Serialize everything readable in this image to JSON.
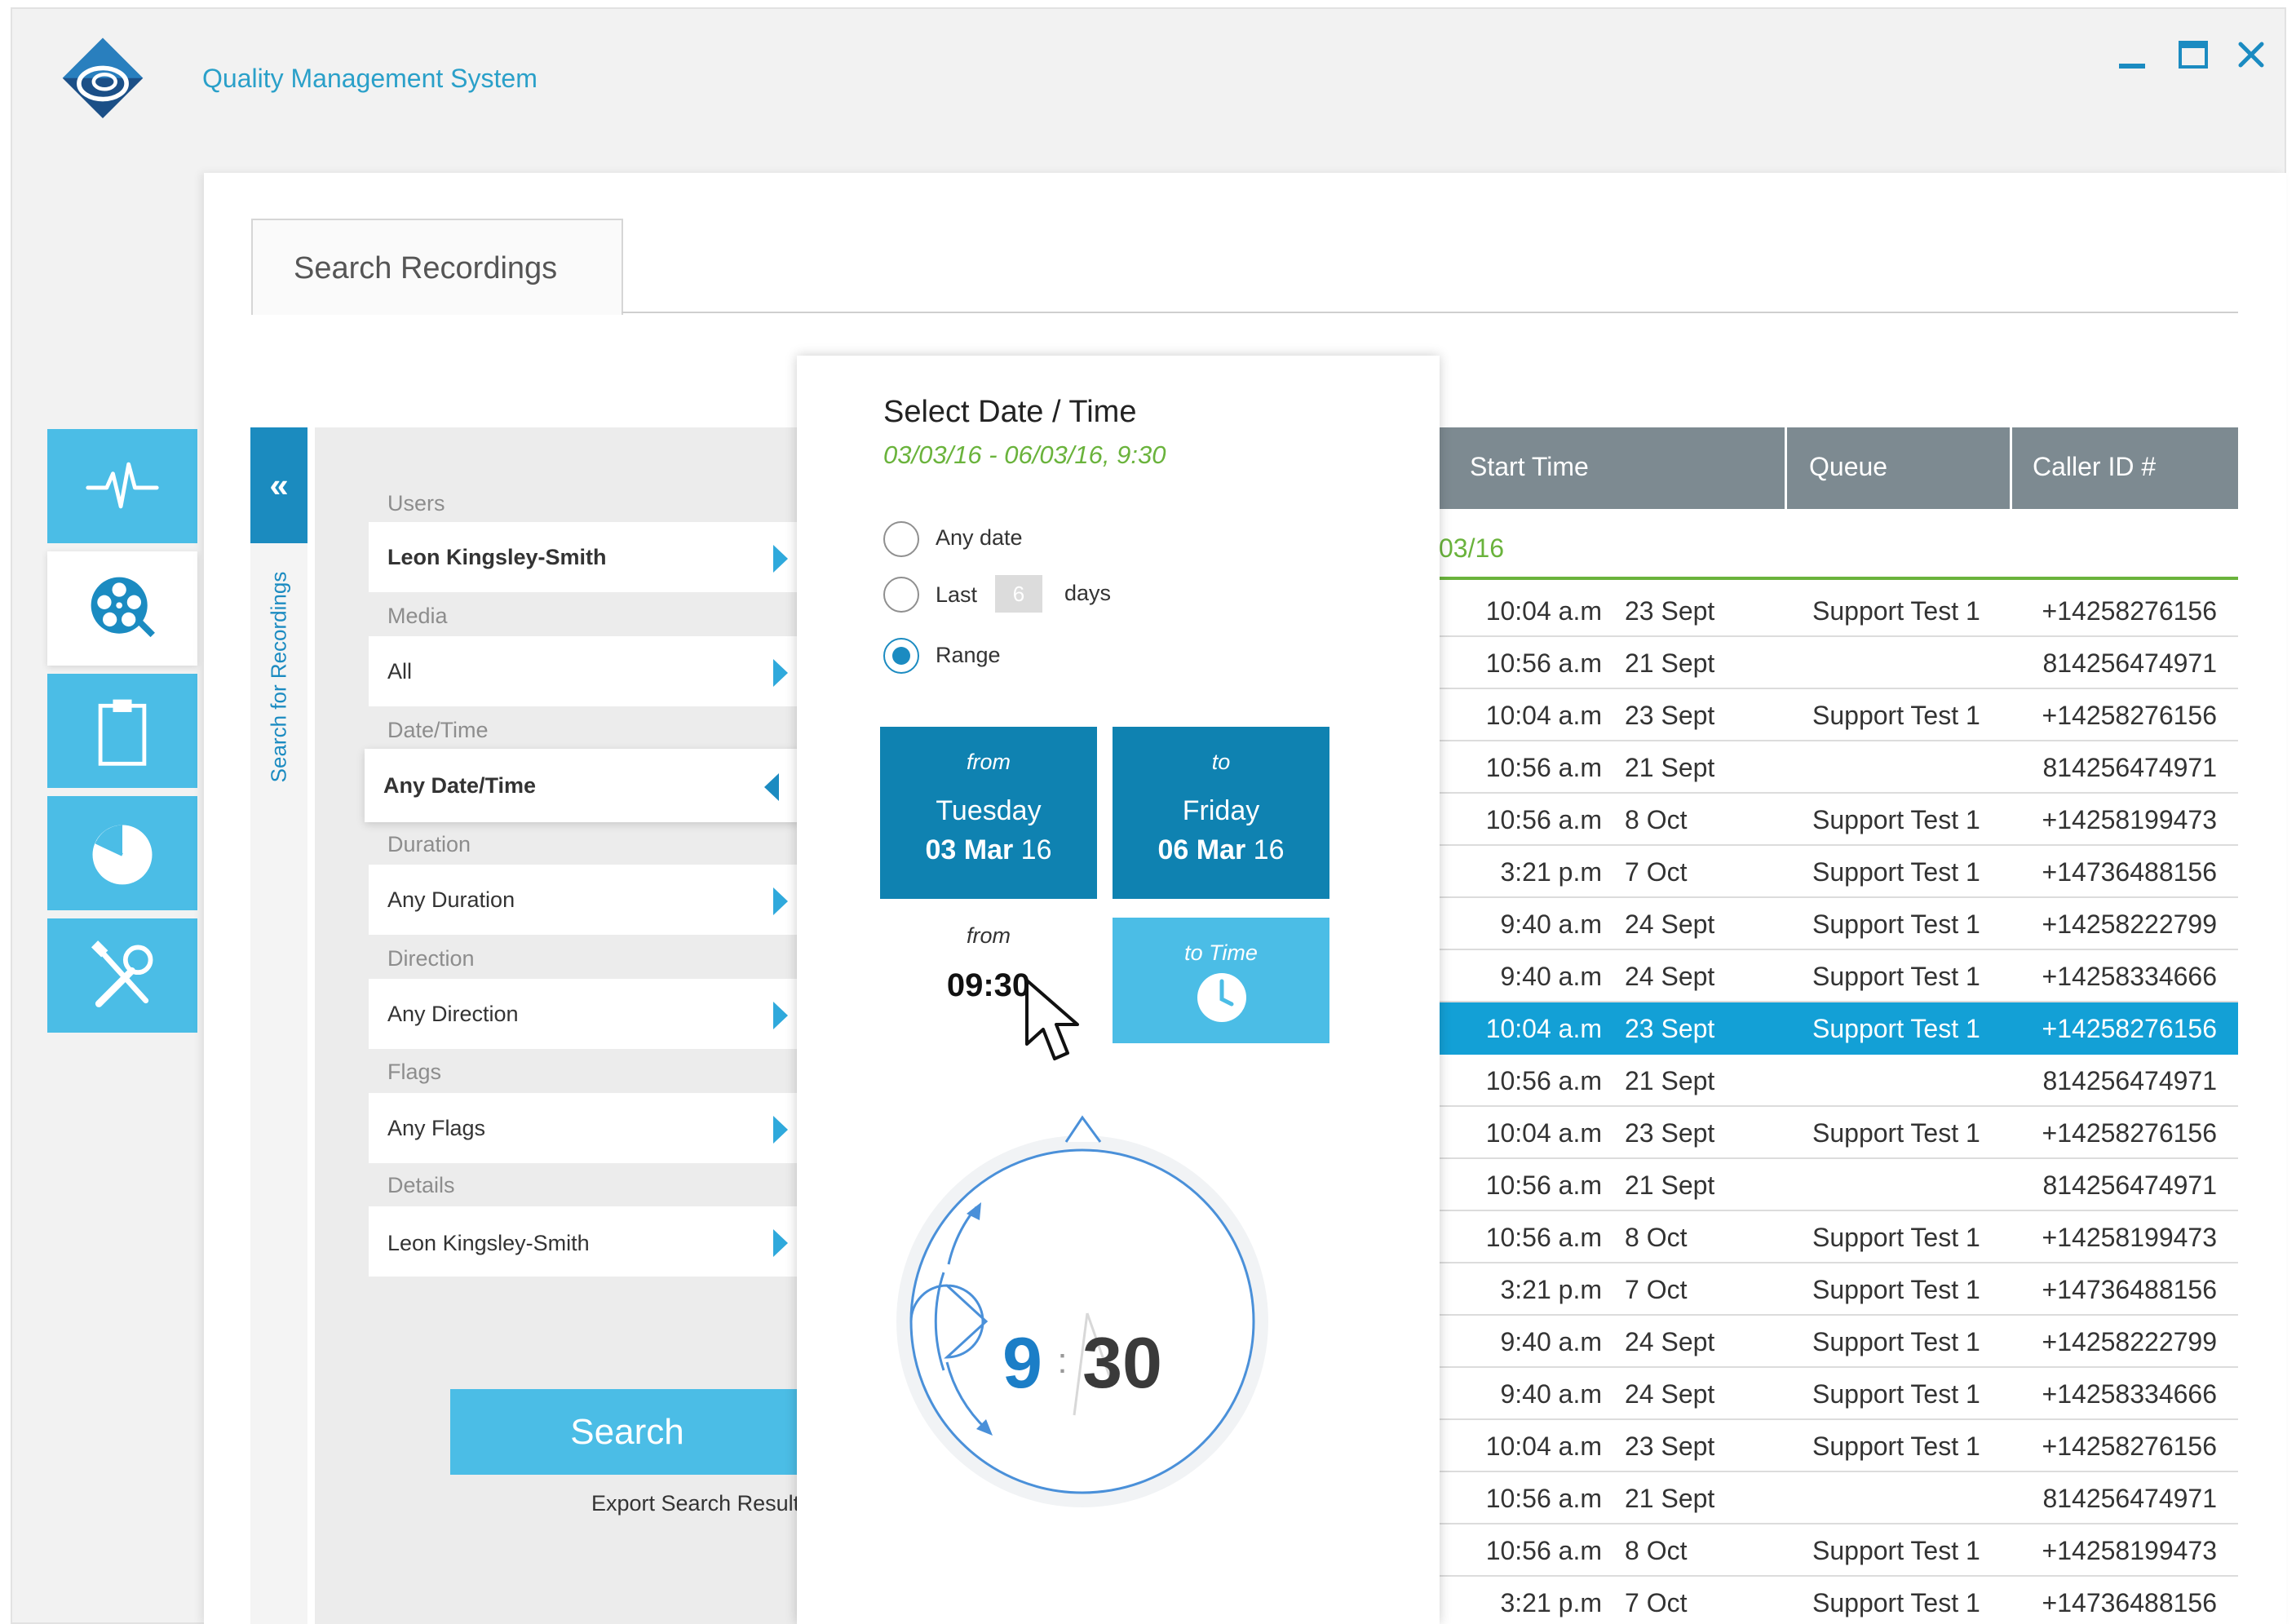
{
  "app": {
    "title": "Quality Management System"
  },
  "tab": {
    "label": "Search Recordings"
  },
  "nav": {
    "items": [
      "activity-icon",
      "film-reel-search-icon",
      "clipboard-icon",
      "pie-chart-icon",
      "tools-icon"
    ],
    "active_index": 1
  },
  "side_panel": {
    "vertical_label": "Search for Recordings",
    "collapse_glyph": "«"
  },
  "filters": {
    "users_label": "Users",
    "users_value": "Leon Kingsley-Smith",
    "media_label": "Media",
    "media_value": "All",
    "datetime_label": "Date/Time",
    "datetime_value": "Any Date/Time",
    "duration_label": "Duration",
    "duration_value": "Any Duration",
    "direction_label": "Direction",
    "direction_value": "Any Direction",
    "flags_label": "Flags",
    "flags_value": "Any Flags",
    "details_label": "Details",
    "details_value": "Leon Kingsley-Smith",
    "search_label": "Search",
    "export_label": "Export Search Result"
  },
  "datetime_popup": {
    "title": "Select Date / Time",
    "summary": "03/03/16 - 06/03/16, 9:30",
    "any_date_label": "Any date",
    "last_label": "Last",
    "last_days_value": "6",
    "days_label": "days",
    "range_label": "Range",
    "selected_option": "Range",
    "from_label": "from",
    "from_day": "Tuesday",
    "from_date_bold": "03 Mar",
    "from_year": "16",
    "to_label": "to",
    "to_day": "Friday",
    "to_date_bold": "06 Mar",
    "to_year": "16",
    "from_time_label": "from",
    "from_time_value": "09:30",
    "to_time_label": "to Time",
    "clock_hour": "9",
    "clock_separator": ":",
    "clock_minute": "30"
  },
  "table": {
    "headers": [
      "Start Time",
      "Queue",
      "Caller ID #"
    ],
    "group_date": "03/16",
    "highlight_index": 8,
    "rows": [
      [
        "10:04 a.m",
        "23 Sept",
        "Support Test 1",
        "+14258276156"
      ],
      [
        "10:56 a.m",
        "21 Sept",
        "",
        "814256474971"
      ],
      [
        "10:04 a.m",
        "23 Sept",
        "Support Test 1",
        "+14258276156"
      ],
      [
        "10:56 a.m",
        "21 Sept",
        "",
        "814256474971"
      ],
      [
        "10:56 a.m",
        "8 Oct",
        "Support Test 1",
        "+14258199473"
      ],
      [
        "3:21 p.m",
        "7 Oct",
        "Support Test 1",
        "+14736488156"
      ],
      [
        "9:40 a.m",
        "24 Sept",
        "Support Test 1",
        "+14258222799"
      ],
      [
        "9:40 a.m",
        "24 Sept",
        "Support Test 1",
        "+14258334666"
      ],
      [
        "10:04 a.m",
        "23 Sept",
        "Support Test 1",
        "+14258276156"
      ],
      [
        "10:56 a.m",
        "21 Sept",
        "",
        "814256474971"
      ],
      [
        "10:04 a.m",
        "23 Sept",
        "Support Test 1",
        "+14258276156"
      ],
      [
        "10:56 a.m",
        "21 Sept",
        "",
        "814256474971"
      ],
      [
        "10:56 a.m",
        "8 Oct",
        "Support Test 1",
        "+14258199473"
      ],
      [
        "3:21 p.m",
        "7 Oct",
        "Support Test 1",
        "+14736488156"
      ],
      [
        "9:40 a.m",
        "24 Sept",
        "Support Test 1",
        "+14258222799"
      ],
      [
        "9:40 a.m",
        "24 Sept",
        "Support Test 1",
        "+14258334666"
      ],
      [
        "10:04 a.m",
        "23 Sept",
        "Support Test 1",
        "+14258276156"
      ],
      [
        "10:56 a.m",
        "21 Sept",
        "",
        "814256474971"
      ],
      [
        "10:56 a.m",
        "8 Oct",
        "Support Test 1",
        "+14258199473"
      ],
      [
        "3:21 p.m",
        "7 Oct",
        "Support Test 1",
        "+14736488156"
      ]
    ]
  },
  "colors": {
    "accent": "#4bbde6",
    "accent_dark": "#1b8bc1",
    "tile_dark": "#0f82b1",
    "highlight_row": "#13a0d6",
    "green": "#6ab33c",
    "table_header": "#7d8a91"
  }
}
